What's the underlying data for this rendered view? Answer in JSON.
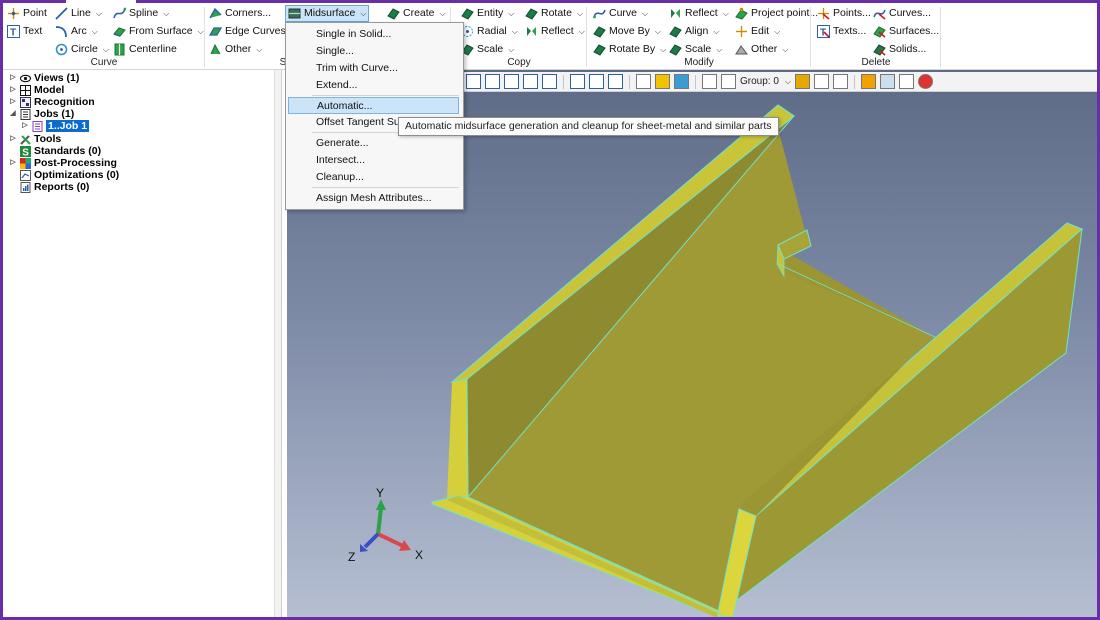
{
  "ribbon": {
    "curve_group": {
      "label": "Curve",
      "point": "Point",
      "text": "Text",
      "line": "Line",
      "arc": "Arc",
      "circle": "Circle",
      "spline": "Spline",
      "from_surface": "From Surface",
      "centerline": "Centerline"
    },
    "surface_group": {
      "label": "S",
      "corners": "Corners...",
      "edge_curves": "Edge Curves...",
      "other": "Other",
      "midsurface": "Midsurface",
      "create": "Create"
    },
    "copy_group": {
      "label": "Copy",
      "entity": "Entity",
      "rotate": "Rotate",
      "radial": "Radial",
      "reflect": "Reflect",
      "scale": "Scale"
    },
    "modify_group": {
      "label": "Modify",
      "curve": "Curve",
      "reflect": "Reflect",
      "project_point": "Project point...",
      "move_by": "Move By",
      "align": "Align",
      "edit": "Edit",
      "rotate_by": "Rotate By",
      "scale": "Scale",
      "other": "Other"
    },
    "delete_group": {
      "label": "Delete",
      "points": "Points...",
      "curves": "Curves...",
      "texts": "Texts...",
      "surfaces": "Surfaces...",
      "solids": "Solids..."
    }
  },
  "midsurface_menu": {
    "items": [
      "Single in Solid...",
      "Single...",
      "Trim with Curve...",
      "Extend...",
      "Automatic...",
      "Offset Tangent Surfa",
      "Generate...",
      "Intersect...",
      "Cleanup...",
      "Assign Mesh Attributes..."
    ],
    "highlighted": "Automatic..."
  },
  "tooltip": "Automatic midsurface generation and cleanup for sheet-metal and similar parts",
  "tree": {
    "items": [
      {
        "label": "Views (1)"
      },
      {
        "label": "Model"
      },
      {
        "label": "Recognition"
      },
      {
        "label": "Jobs (1)"
      },
      {
        "label": "1..Job 1"
      },
      {
        "label": "Tools"
      },
      {
        "label": "Standards (0)"
      },
      {
        "label": "Post-Processing"
      },
      {
        "label": "Optimizations (0)"
      },
      {
        "label": "Reports (0)"
      }
    ]
  },
  "view_toolbar": {
    "group_label": "Group: 0"
  },
  "axes": {
    "x": "X",
    "y": "Y",
    "z": "Z"
  },
  "colors": {
    "accent": "#6a2da8",
    "part_face": "#a8a436",
    "part_face_light": "#c9c43a",
    "part_edge": "#62e3c8",
    "viewport_top": "#5c6a86",
    "viewport_bottom": "#b6bfd2",
    "selection": "#0a6ccf"
  }
}
